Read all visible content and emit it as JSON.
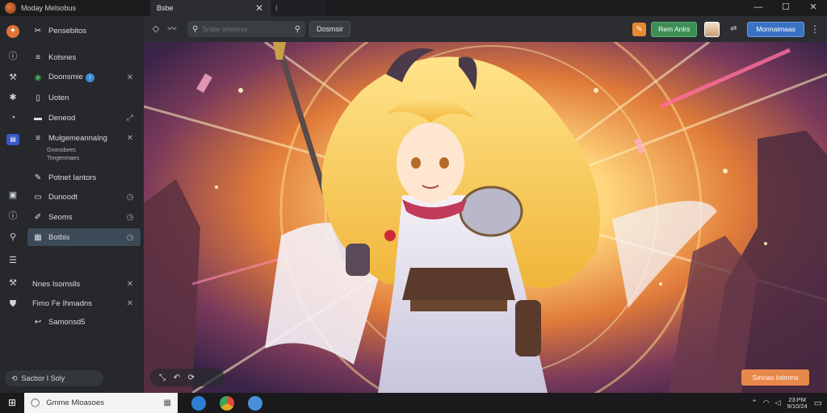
{
  "window": {
    "title": "Moday Melsobus",
    "tab_label": "Bsbe",
    "tab2_label": "I",
    "controls": [
      "—",
      "☐",
      "✕"
    ]
  },
  "sidebar": {
    "rail_icons": [
      "info-icon",
      "wrench-icon",
      "puzzle-icon",
      "palette-icon",
      "chat-icon"
    ],
    "items": [
      {
        "icon": "✂",
        "label": "Pensebitos",
        "right": ""
      },
      {
        "icon": "≡",
        "label": "Kotsnes",
        "right": ""
      },
      {
        "icon": "◉",
        "label": "Doonsmie",
        "right": "✕",
        "badge": "i"
      },
      {
        "icon": "▯",
        "label": "Uoten",
        "right": ""
      },
      {
        "icon": "▬",
        "label": "Deneod",
        "right": "⤢"
      },
      {
        "icon": "≡",
        "label": "Mulgemeannalng",
        "right": "✕"
      },
      {
        "icon": "✎",
        "label": "Potnet Iantors",
        "right": ""
      },
      {
        "icon": "▭",
        "label": "Dunoodt",
        "right": "◷"
      },
      {
        "icon": "✐",
        "label": "Seoms",
        "right": "◷"
      },
      {
        "icon": "▦",
        "label": "Botbis",
        "right": "◷",
        "active": true
      },
      {
        "icon": "",
        "label": "Nnes Isomslls",
        "right": "✕"
      },
      {
        "icon": "",
        "label": "Fimo Fe Ihmadns",
        "right": "✕"
      },
      {
        "icon": "↩",
        "label": "Samonsd5",
        "right": ""
      }
    ],
    "sub_lines": [
      "Gnonsbees",
      "Timgenmaes"
    ],
    "status": "Sacbor I Soly"
  },
  "toolbar": {
    "search_placeholder": "Srsbe sinemss",
    "search_button": "Dosmsir",
    "green_button": "Rem Anlrs",
    "blue_button": "Monnaimaas"
  },
  "canvas": {
    "cta_button": "Smnao Intmms"
  },
  "taskbar": {
    "search_label": "Gmme Mloasoes",
    "apps": [
      {
        "name": "edge-app",
        "color": "#2d7fd3"
      },
      {
        "name": "chrome-app",
        "color": "#e5a823"
      },
      {
        "name": "browser-app",
        "color": "#4a90d9"
      }
    ],
    "clock_time": "23:PM",
    "clock_date": "9/10/24"
  }
}
